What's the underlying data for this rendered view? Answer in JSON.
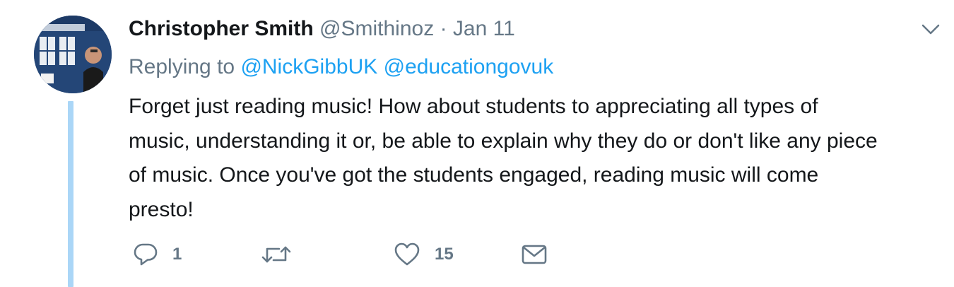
{
  "tweet": {
    "author": {
      "name": "Christopher Smith",
      "handle": "@Smithinoz"
    },
    "separator": "·",
    "date": "Jan 11",
    "replying_label": "Replying to",
    "replying_to": [
      "@NickGibbUK",
      "@educationgovuk"
    ],
    "text": "Forget just reading music! How about students to appreciating all types of\nmusic, understanding it or, be able to explain why they do or don't like any piece\nof music. Once you've got the students engaged, reading music will come\npresto!",
    "actions": {
      "reply": {
        "icon": "reply-icon",
        "count": "1"
      },
      "retweet": {
        "icon": "retweet-icon",
        "count": ""
      },
      "like": {
        "icon": "heart-icon",
        "count": "15"
      },
      "dm": {
        "icon": "envelope-icon"
      }
    },
    "menu_icon": "chevron-down-icon"
  },
  "colors": {
    "text": "#14171a",
    "secondary": "#657786",
    "link": "#1da1f2",
    "thread_line": "#aad6f7"
  }
}
